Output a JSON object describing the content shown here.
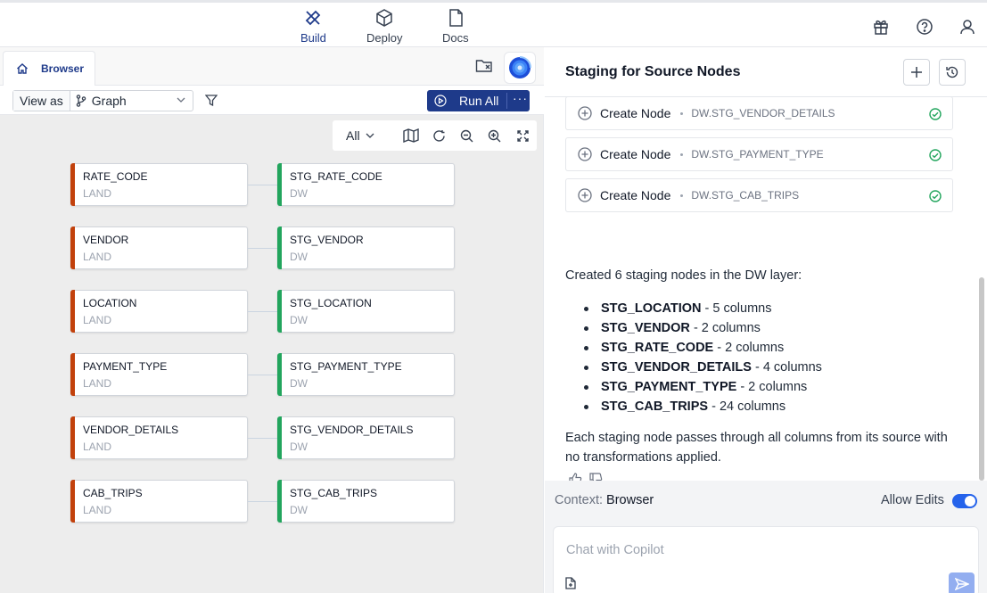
{
  "nav": {
    "build": "Build",
    "deploy": "Deploy",
    "docs": "Docs",
    "active": "Build"
  },
  "left": {
    "tab_label": "Browser",
    "view_as_label": "View as",
    "view_mode": "Graph",
    "run_all": "Run All",
    "run_more": "···",
    "scope": "All",
    "rows": [
      {
        "source": {
          "name": "RATE_CODE",
          "layer": "LAND"
        },
        "target": {
          "name": "STG_RATE_CODE",
          "layer": "DW"
        }
      },
      {
        "source": {
          "name": "VENDOR",
          "layer": "LAND"
        },
        "target": {
          "name": "STG_VENDOR",
          "layer": "DW"
        }
      },
      {
        "source": {
          "name": "LOCATION",
          "layer": "LAND"
        },
        "target": {
          "name": "STG_LOCATION",
          "layer": "DW"
        }
      },
      {
        "source": {
          "name": "PAYMENT_TYPE",
          "layer": "LAND"
        },
        "target": {
          "name": "STG_PAYMENT_TYPE",
          "layer": "DW"
        }
      },
      {
        "source": {
          "name": "VENDOR_DETAILS",
          "layer": "LAND"
        },
        "target": {
          "name": "STG_VENDOR_DETAILS",
          "layer": "DW"
        }
      },
      {
        "source": {
          "name": "CAB_TRIPS",
          "layer": "LAND"
        },
        "target": {
          "name": "STG_CAB_TRIPS",
          "layer": "DW"
        }
      }
    ]
  },
  "right": {
    "title": "Staging for Source Nodes",
    "actions": [
      {
        "label": "Create Node",
        "target": "DW.STG_VENDOR_DETAILS"
      },
      {
        "label": "Create Node",
        "target": "DW.STG_PAYMENT_TYPE"
      },
      {
        "label": "Create Node",
        "target": "DW.STG_CAB_TRIPS"
      }
    ],
    "summary": "Created 6 staging nodes in the DW layer:",
    "bullets": [
      {
        "name": "STG_LOCATION",
        "detail": " - 5 columns"
      },
      {
        "name": "STG_VENDOR",
        "detail": " - 2 columns"
      },
      {
        "name": "STG_RATE_CODE",
        "detail": " - 2 columns"
      },
      {
        "name": "STG_VENDOR_DETAILS",
        "detail": " - 4 columns"
      },
      {
        "name": "STG_PAYMENT_TYPE",
        "detail": " - 2 columns"
      },
      {
        "name": "STG_CAB_TRIPS",
        "detail": " - 24 columns"
      }
    ],
    "closing": "Each staging node passes through all columns from its source with no transformations applied.",
    "context_label": "Context:",
    "context_value": "Browser",
    "allow_edits_label": "Allow Edits",
    "allow_edits": true,
    "chat_placeholder": "Chat with Copilot"
  },
  "colors": {
    "brand": "#1e3a8a",
    "land": "#c2410c",
    "dw": "#22a55d",
    "toggle": "#2563eb"
  }
}
